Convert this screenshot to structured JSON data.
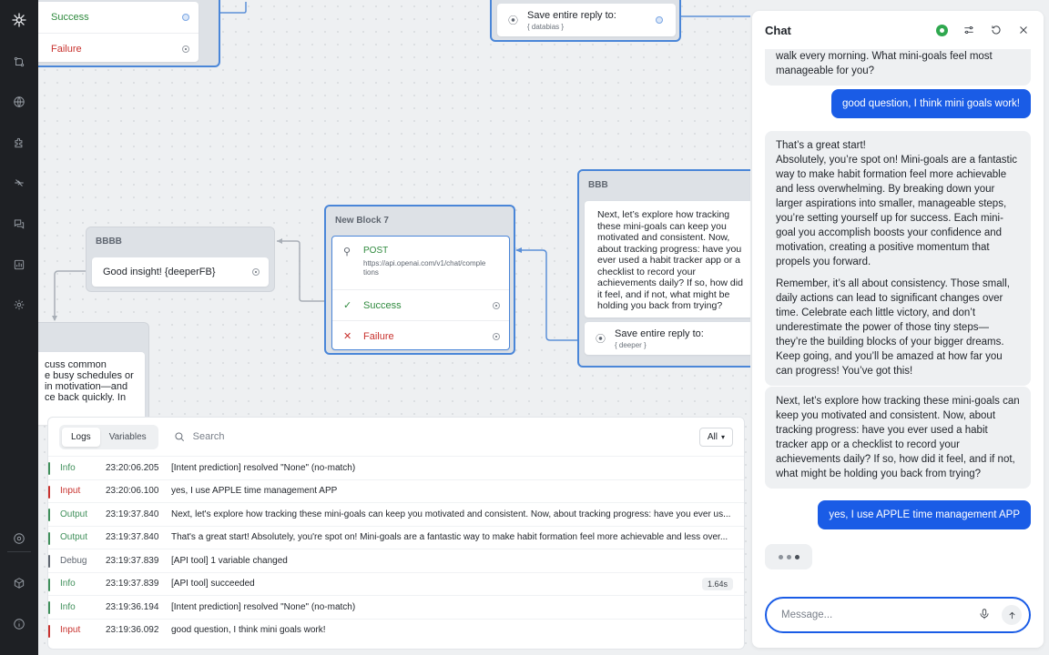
{
  "nav": {
    "items": [
      "logo-icon",
      "flows-icon",
      "globe-icon",
      "puzzle-icon",
      "integrations-icon",
      "chat-bubbles-icon",
      "analytics-icon",
      "settings-icon",
      "help-circle-icon",
      "cube-icon",
      "info-icon"
    ]
  },
  "canvas": {
    "top_left_block": {
      "success": "Success",
      "failure": "Failure"
    },
    "top_center_block": {
      "save_label": "Save entire reply to:",
      "save_var": "{ databias }"
    },
    "bbbb_block": {
      "title": "BBBB",
      "message": "Good insight! {deeperFB}"
    },
    "partial_block": {
      "lines": [
        "cuss common",
        "e busy schedules or",
        "in motivation—and",
        "ce back quickly. In"
      ]
    },
    "new_block_7": {
      "title": "New Block 7",
      "method": "POST",
      "url_line1": "https://api.openai.com/v1/chat/comple",
      "url_line2": "tions",
      "success": "Success",
      "failure": "Failure"
    },
    "bbb_block": {
      "title": "BBB",
      "message_lines": [
        "Next, let’s explore how tracking",
        "these mini-goals can keep you",
        "motivated and consistent. Now,",
        "about tracking progress: have you",
        "ever used a habit tracker app or a",
        "checklist to record your",
        "achievements daily? If so, how did",
        "it feel, and if not, what might be",
        "holding you back from trying?"
      ],
      "save_label": "Save entire reply to:",
      "save_var": "{ deeper }"
    }
  },
  "logs": {
    "tabs": [
      {
        "label": "Logs",
        "active": true
      },
      {
        "label": "Variables",
        "active": false
      }
    ],
    "search_placeholder": "Search",
    "filter": "All",
    "rows": [
      {
        "level": "Info",
        "color": "#3f8f5a",
        "time": "23:20:06.205",
        "message": "[Intent prediction] resolved \"None\" (no-match)"
      },
      {
        "level": "Input",
        "color": "#c8322e",
        "time": "23:20:06.100",
        "message": "yes, I use APPLE time management APP"
      },
      {
        "level": "Output",
        "color": "#3f8f5a",
        "time": "23:19:37.840",
        "message": "Next, let's explore how tracking these mini-goals can keep you motivated and consistent. Now, about tracking progress: have you ever us..."
      },
      {
        "level": "Output",
        "color": "#3f8f5a",
        "time": "23:19:37.840",
        "message": "That's a great start! Absolutely, you're spot on! Mini-goals are a fantastic way to make habit formation feel more achievable and less over..."
      },
      {
        "level": "Debug",
        "color": "#5f6670",
        "time": "23:19:37.839",
        "message": "[API tool] 1 variable changed"
      },
      {
        "level": "Info",
        "color": "#3f8f5a",
        "time": "23:19:37.839",
        "message": "[API tool] succeeded",
        "badge": "1.64s"
      },
      {
        "level": "Info",
        "color": "#3f8f5a",
        "time": "23:19:36.194",
        "message": "[Intent prediction] resolved \"None\" (no-match)"
      },
      {
        "level": "Input",
        "color": "#c8322e",
        "time": "23:19:36.092",
        "message": "good question, I think mini goals work!"
      }
    ]
  },
  "chat": {
    "title": "Chat",
    "status_color": "#2fa84f",
    "messages": {
      "m0": "walk every morning. What mini-goals feel most manageable for you?",
      "m1": "good question, I think mini goals work!",
      "m2a": "That’s a great start!",
      "m2b": "Absolutely, you’re spot on! Mini-goals are a fantastic way to make habit formation feel more achievable and less overwhelming. By breaking down your larger aspirations into smaller, manageable steps, you’re setting yourself up for success. Each mini-goal you accomplish boosts your confidence and motivation, creating a positive momentum that propels you forward.",
      "m2c": "Remember, it’s all about consistency. Those small, daily actions can lead to significant changes over time. Celebrate each little victory, and don’t underestimate the power of those tiny steps—they’re the building blocks of your bigger dreams. Keep going, and you’ll be amazed at how far you can progress! You’ve got this!",
      "m3": "Next, let’s explore how tracking these mini-goals can keep you motivated and consistent. Now, about tracking progress: have you ever used a habit tracker app or a checklist to record your achievements daily? If so, how did it feel, and if not, what might be holding you back from trying?",
      "m4": "yes, I use APPLE time management APP"
    },
    "input_placeholder": "Message..."
  }
}
